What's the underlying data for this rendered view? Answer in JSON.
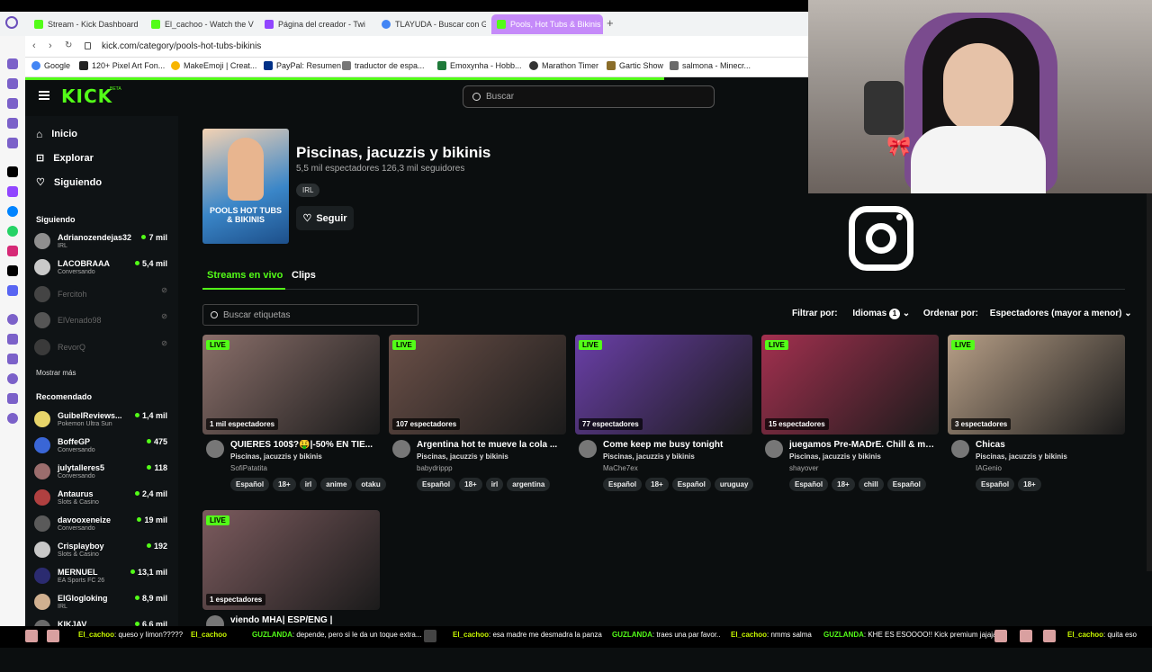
{
  "browser": {
    "tabs": [
      {
        "label": "Stream - Kick Dashboard",
        "active": false
      },
      {
        "label": "El_cachoo - Watch the VOD",
        "active": false
      },
      {
        "label": "Página del creador - Twi",
        "active": false
      },
      {
        "label": "TLAYUDA - Buscar con G",
        "active": false
      },
      {
        "label": "Pools, Hot Tubs & Bikinis",
        "active": true
      }
    ],
    "new_tab": "+",
    "url": "kick.com/category/pools-hot-tubs-bikinis",
    "bookmarks": [
      "Google",
      "120+ Pixel Art Fon...",
      "MakeEmoji | Creat...",
      "PayPal: Resumen",
      "traductor de espa...",
      "Emoxynha - Hobb...",
      "Marathon Timer",
      "Gartic Show",
      "salmona - Minecr..."
    ]
  },
  "header": {
    "logo": "KICK",
    "logo_badge": "BETA",
    "search_placeholder": "Buscar"
  },
  "sidebar": {
    "nav": [
      {
        "label": "Inicio",
        "icon": "home-icon"
      },
      {
        "label": "Explorar",
        "icon": "compass-icon"
      },
      {
        "label": "Siguiendo",
        "icon": "heart-icon"
      }
    ],
    "following_title": "Siguiendo",
    "following": [
      {
        "name": "Adrianozendejas32",
        "category": "IRL",
        "viewers": "7 mil",
        "online": true
      },
      {
        "name": "LACOBRAAA",
        "category": "Conversando",
        "viewers": "5,4 mil",
        "online": true
      },
      {
        "name": "Fercitoh",
        "category": "",
        "viewers": "",
        "online": false
      },
      {
        "name": "ElVenado98",
        "category": "",
        "viewers": "",
        "online": false
      },
      {
        "name": "RevorQ",
        "category": "",
        "viewers": "",
        "online": false
      }
    ],
    "show_more": "Mostrar más",
    "recommended_title": "Recomendado",
    "recommended": [
      {
        "name": "GuibelReviews...",
        "category": "Pokemon Ultra Sun",
        "viewers": "1,4 mil"
      },
      {
        "name": "BoffeGP",
        "category": "Conversando",
        "viewers": "475"
      },
      {
        "name": "julytalleres5",
        "category": "Conversando",
        "viewers": "118"
      },
      {
        "name": "Antaurus",
        "category": "Slots & Casino",
        "viewers": "2,4 mil"
      },
      {
        "name": "davooxeneize",
        "category": "Conversando",
        "viewers": "19 mil"
      },
      {
        "name": "Crisplayboy",
        "category": "Slots & Casino",
        "viewers": "192"
      },
      {
        "name": "MERNUEL",
        "category": "EA Sports FC 26",
        "viewers": "13,1 mil"
      },
      {
        "name": "ElGlogloking",
        "category": "IRL",
        "viewers": "8,9 mil"
      },
      {
        "name": "KIKJAV",
        "category": "",
        "viewers": "6,6 mil"
      }
    ]
  },
  "category": {
    "cover_text": "POOLS HOT TUBS & BIKINIS",
    "title": "Piscinas, jacuzzis y bikinis",
    "stats": "5,5 mil espectadores  126,3 mil seguidores",
    "tag": "IRL",
    "follow_label": "Seguir"
  },
  "page_tabs": [
    "Streams en vivo",
    "Clips"
  ],
  "tag_search_placeholder": "Buscar etiquetas",
  "filters": {
    "filter_label": "Filtrar por:",
    "languages_label": "Idiomas",
    "languages_count": "1",
    "sort_label": "Ordenar por:",
    "sort_value": "Espectadores (mayor a menor)"
  },
  "live_badge": "LIVE",
  "streams": [
    {
      "title": "QUIERES 100$?🤑|-50% EN TIE...",
      "category": "Piscinas, jacuzzis y bikinis",
      "user": "SofiPatatita",
      "viewers": "1 mil espectadores",
      "tags": [
        "Español",
        "18+",
        "irl",
        "anime",
        "otaku"
      ],
      "thumb_color": "#8a6f6a"
    },
    {
      "title": "Argentina hot te mueve la cola ...",
      "category": "Piscinas, jacuzzis y bikinis",
      "user": "babydrippp",
      "viewers": "107 espectadores",
      "tags": [
        "Español",
        "18+",
        "irl",
        "argentina"
      ],
      "thumb_color": "#6b5048"
    },
    {
      "title": "Come keep me busy tonight",
      "category": "Piscinas, jacuzzis y bikinis",
      "user": "MaChe7ex",
      "viewers": "77 espectadores",
      "tags": [
        "Español",
        "18+",
        "Español",
        "uruguay"
      ],
      "thumb_color": "#6a3fa8"
    },
    {
      "title": "juegamos Pre-MADrE. Chill & ma...",
      "category": "Piscinas, jacuzzis y bikinis",
      "user": "shayover",
      "viewers": "15 espectadores",
      "tags": [
        "Español",
        "18+",
        "chill",
        "Español"
      ],
      "thumb_color": "#a3304f"
    },
    {
      "title": "Chicas",
      "category": "Piscinas, jacuzzis y bikinis",
      "user": "IAGenio",
      "viewers": "3 espectadores",
      "tags": [
        "Español",
        "18+"
      ],
      "thumb_color": "#b79f87"
    },
    {
      "title": "viendo MHA| ESP/ENG |",
      "category": "Piscinas, jacuzzis y bikinis",
      "user": "",
      "viewers": "1 espectadores",
      "tags": [],
      "thumb_color": "#7c5b5e"
    }
  ],
  "chat": [
    {
      "user": "El_cachoo",
      "msg": ": queso y limon?????"
    },
    {
      "user": "El_cachoo",
      "msg": ""
    },
    {
      "user": "GUZLANDA",
      "msg": ": depende, pero si le da un toque extra..."
    },
    {
      "user": "El_cachoo",
      "msg": ": esa madre me desmadra la panza"
    },
    {
      "user": "GUZLANDA",
      "msg": ": traes una par favor.."
    },
    {
      "user": "El_cachoo",
      "msg": ": nmms salma"
    },
    {
      "user": "GUZLANDA",
      "msg": ": KHE ES ESOOOO!! Kick premium jajaja"
    },
    {
      "user": "El_cachoo",
      "msg": ": quita eso"
    }
  ]
}
